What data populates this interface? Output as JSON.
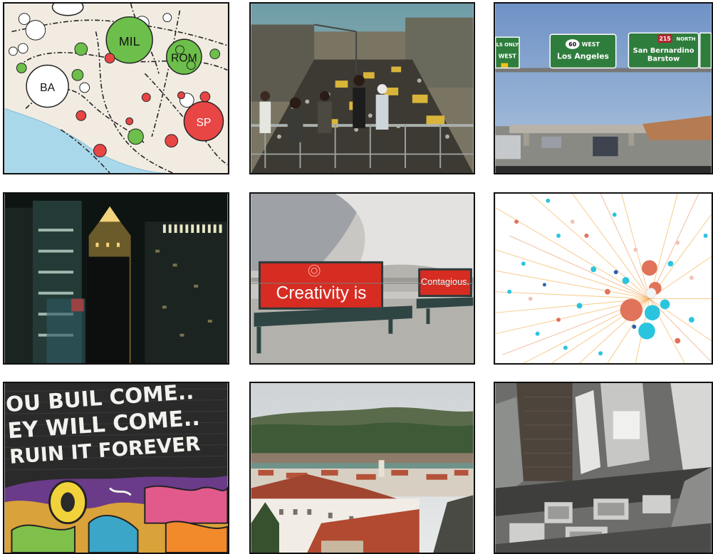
{
  "grid": {
    "tiles": [
      {
        "id": "map",
        "labels": {
          "mil": "MIL",
          "rom": "ROM",
          "ba": "BA",
          "sp": "SP"
        }
      },
      {
        "id": "crowd"
      },
      {
        "id": "freeway",
        "signs": {
          "left": "LS ONLY",
          "left_dir": "WEST",
          "route_num": "60",
          "route_dir": "WEST",
          "la": "Los Angeles",
          "i_num": "215",
          "i_dir": "NORTH",
          "sb": "San Bernardino",
          "barstow": "Barstow"
        }
      },
      {
        "id": "night-city"
      },
      {
        "id": "benches",
        "texts": {
          "main": "Creativity is",
          "second": "Contagious."
        }
      },
      {
        "id": "network-burst"
      },
      {
        "id": "graffiti",
        "lines": [
          "OU BUIL COME..",
          "EY WILL COME..",
          "RUIN IT FOREVER"
        ]
      },
      {
        "id": "town"
      },
      {
        "id": "aerial-city"
      }
    ]
  }
}
